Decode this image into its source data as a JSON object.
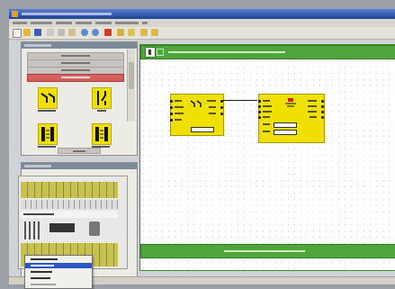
{
  "app": {
    "title": "",
    "menu_items": [
      "",
      "",
      "",
      "",
      "",
      "",
      ""
    ]
  },
  "toolbar": {
    "button_icons": [
      "new-file-icon",
      "open-folder-icon",
      "save-icon",
      "cut-icon",
      "copy-icon",
      "paste-icon",
      "zoom-in-icon",
      "zoom-out-icon",
      "run-icon",
      "print-icon",
      "grid-icon",
      "undo-icon",
      "redo-icon"
    ]
  },
  "symbol_library": {
    "header": "",
    "categories": [
      {
        "label": "",
        "active": false
      },
      {
        "label": "",
        "active": false
      },
      {
        "label": "",
        "active": false
      },
      {
        "label": "",
        "active": true
      }
    ],
    "symbols": [
      {
        "label": "",
        "icon": "two-hand-switch-icon"
      },
      {
        "label": "",
        "icon": "contact-switch-icon"
      },
      {
        "label": "",
        "icon": "light-curtain-icon"
      },
      {
        "label": "",
        "icon": "light-curtain-icon"
      }
    ],
    "footer": ""
  },
  "hardware_panel": {
    "header": "",
    "brand": ""
  },
  "context_menu": {
    "items": [
      {
        "label": "",
        "highlighted": false
      },
      {
        "label": "",
        "highlighted": true
      },
      {
        "label": "",
        "highlighted": false
      },
      {
        "label": "",
        "highlighted": false
      },
      {
        "label": "",
        "highlighted": false
      }
    ]
  },
  "canvas": {
    "header_number": "",
    "header_text": "",
    "footer_text": "",
    "block_input": {
      "icon": "two-hand-switch-icon",
      "ports_left": [
        "",
        "",
        "",
        ""
      ],
      "ports_right": [
        "",
        "",
        ""
      ],
      "field_value": ""
    },
    "block_output": {
      "icon": "relay-icon",
      "ports_left": [
        "",
        "",
        "",
        "",
        "",
        "",
        ""
      ],
      "ports_right": [
        "",
        "",
        "",
        ""
      ]
    }
  },
  "colors": {
    "title_bar": "#1f3f9a",
    "canvas_border": "#3c8f2c",
    "section_bar": "#4fa63a",
    "block_fill": "#f0e000",
    "active_category": "#d46060",
    "menu_highlight": "#2a57c4"
  }
}
